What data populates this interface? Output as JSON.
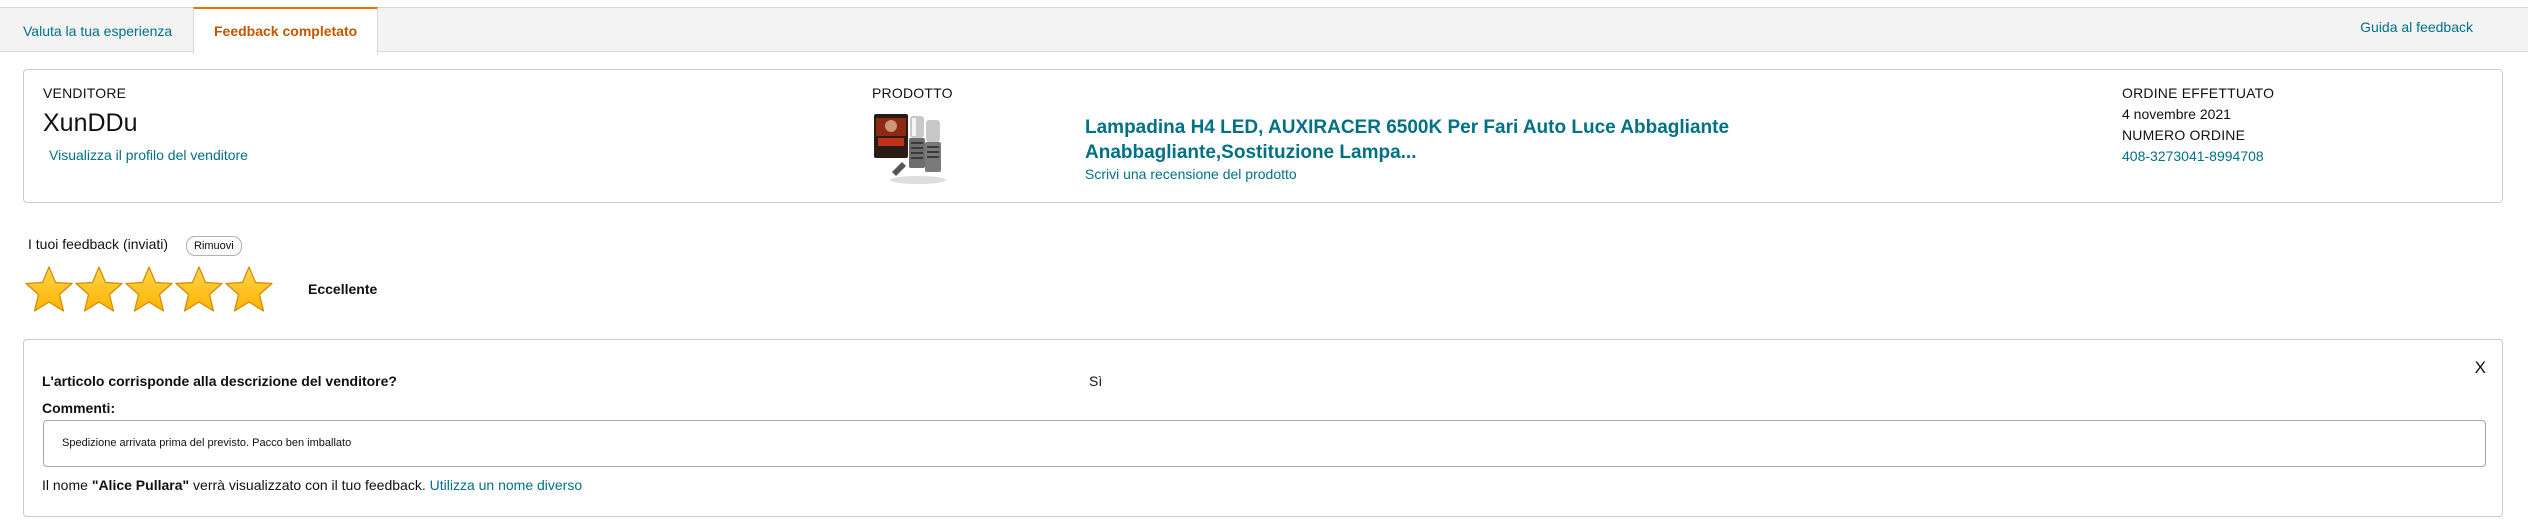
{
  "tabs": {
    "rate": "Valuta la tua esperienza",
    "completed": "Feedback completato"
  },
  "guide_link": "Guida al feedback",
  "order": {
    "seller_label": "VENDITORE",
    "seller_name": "XunDDu",
    "seller_profile_link": "Visualizza il profilo del venditore",
    "product_label": "PRODOTTO",
    "product_title": "Lampadina H4 LED, AUXIRACER 6500K Per Fari Auto Luce Abbagliante Anabbagliante,Sostituzione Lampa...",
    "product_review_link": "Scrivi una recensione del prodotto",
    "order_date_label": "ORDINE EFFETTUATO",
    "order_date": "4 novembre 2021",
    "order_number_label": "NUMERO ORDINE",
    "order_number": "408-3273041-8994708"
  },
  "feedback": {
    "title": "I tuoi feedback (inviati)",
    "remove_button": "Rimuovi",
    "rating": 5,
    "rating_max": 5,
    "rating_text": "Eccellente"
  },
  "question": {
    "text": "L'articolo corrisponde alla descrizione del venditore?",
    "answer": "Sì",
    "close_icon": "X",
    "comments_label": "Commenti:",
    "comment": "Spedizione arrivata prima del previsto. Pacco ben imballato"
  },
  "name_notice": {
    "prefix": "Il nome ",
    "name": "\"Alice Pullara\"",
    "suffix": " verrà visualizzato con il tuo feedback. ",
    "link": "Utilizza un nome diverso"
  },
  "colors": {
    "link": "#007185",
    "active_tab": "#c45500",
    "star_fill": "#ffb300"
  }
}
